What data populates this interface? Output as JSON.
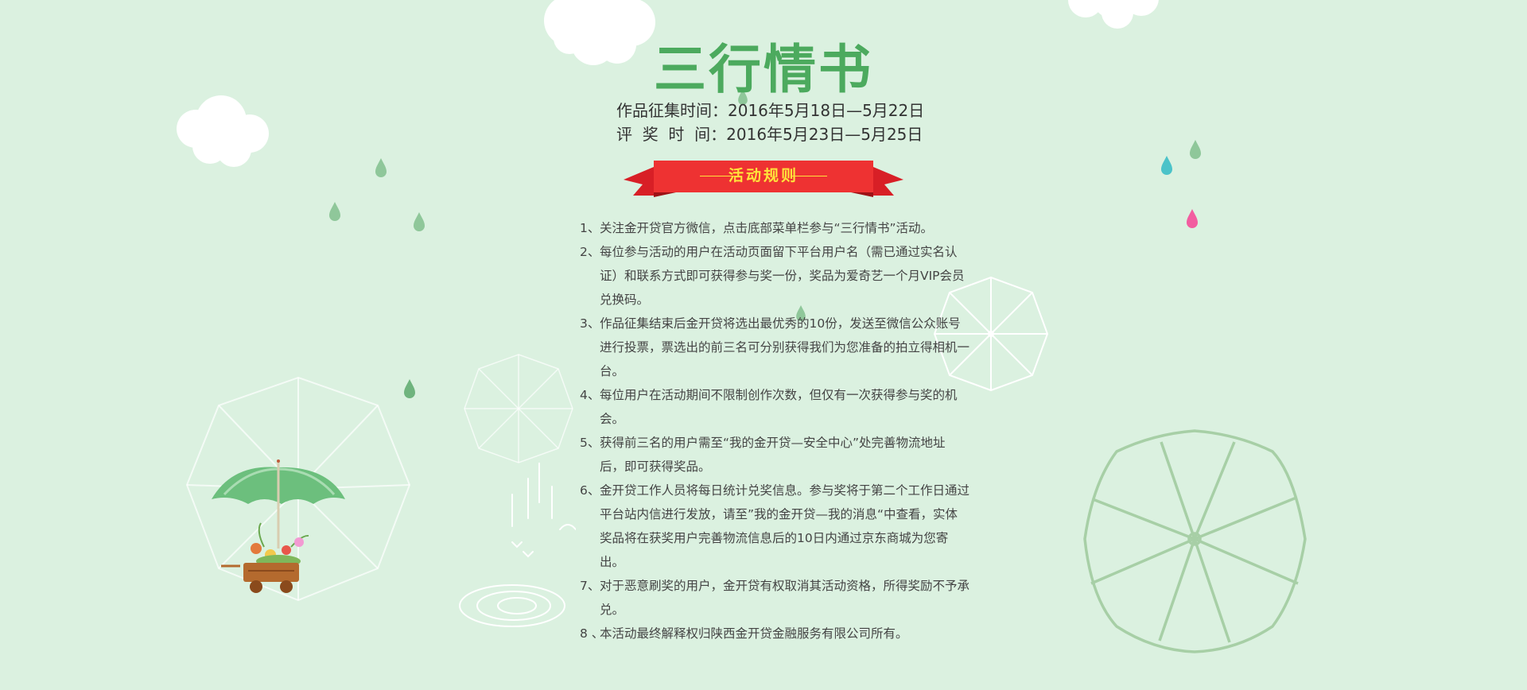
{
  "title": "三行情书",
  "dates": {
    "collect": "作品征集时间：2016年5月18日—5月22日",
    "judge": "评  奖  时  间：2016年5月23日—5月25日"
  },
  "banner": {
    "label": "活动规则"
  },
  "rules": [
    {
      "num": "1、",
      "text": "关注金开贷官方微信，点击底部菜单栏参与“三行情书”活动。"
    },
    {
      "num": "2、",
      "text": "每位参与活动的用户在活动页面留下平台用户名（需已通过实名认证）和联系方式即可获得参与奖一份，奖品为爱奇艺一个月VIP会员兑换码。"
    },
    {
      "num": "3、",
      "text": "作品征集结束后金开贷将选出最优秀的10份，发送至微信公众账号进行投票，票选出的前三名可分别获得我们为您准备的拍立得相机一台。"
    },
    {
      "num": "4、",
      "text": "每位用户在活动期间不限制创作次数，但仅有一次获得参与奖的机会。"
    },
    {
      "num": "5、",
      "text": "获得前三名的用户需至“我的金开贷—安全中心”处完善物流地址后，即可获得奖品。"
    },
    {
      "num": "6、",
      "text": "金开贷工作人员将每日统计兑奖信息。参与奖将于第二个工作日通过平台站内信进行发放，请至”我的金开贷—我的消息“中查看，实体奖品将在获奖用户完善物流信息后的10日内通过京东商城为您寄出。"
    },
    {
      "num": "7、",
      "text": "对于恶意刷奖的用户，金开贷有权取消其活动资格，所得奖励不予承兑。"
    },
    {
      "num": "8 、",
      "text": "本活动最终解释权归陕西金开贷金融服务有限公司所有。"
    }
  ],
  "colors": {
    "background": "#dbf1e0",
    "title_green": "#4caa5e",
    "banner_red": "#ee3232",
    "banner_text": "#ffe33b",
    "drop_green": "#7fbf8a",
    "drop_blue": "#4bc3c9",
    "drop_pink": "#f25da0"
  },
  "icons": [
    "cloud-icon",
    "raindrop-icon",
    "umbrella-outline-icon",
    "umbrella-flower-cart-icon",
    "water-ripple-icon"
  ]
}
